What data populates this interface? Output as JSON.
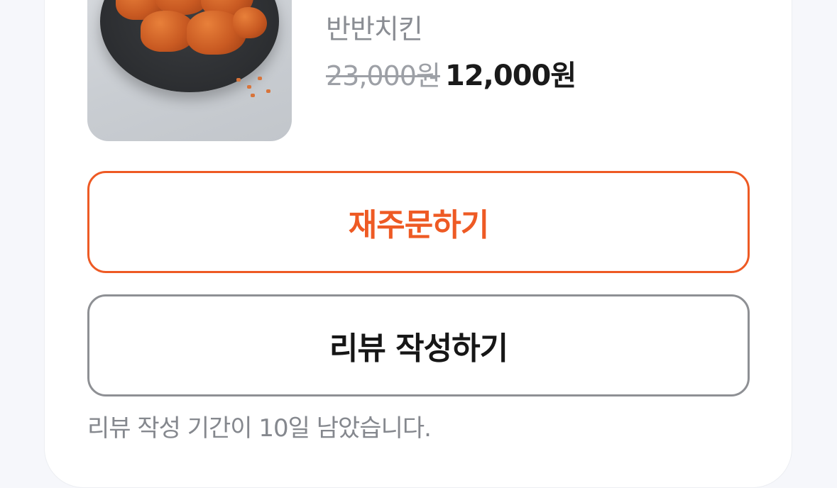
{
  "order_item": {
    "image_alt": "반반치킨",
    "name": "반반치킨",
    "original_price": "23,000원",
    "sale_price": "12,000원"
  },
  "actions": {
    "reorder_label": "재주문하기",
    "review_label": "리뷰 작성하기"
  },
  "review_notice": "리뷰 작성 기간이 10일 남았습니다.",
  "colors": {
    "accent": "#ee5a24",
    "background": "#f6f7fb",
    "card": "#ffffff",
    "muted_text": "#85888e",
    "secondary_border": "#8e9094"
  }
}
